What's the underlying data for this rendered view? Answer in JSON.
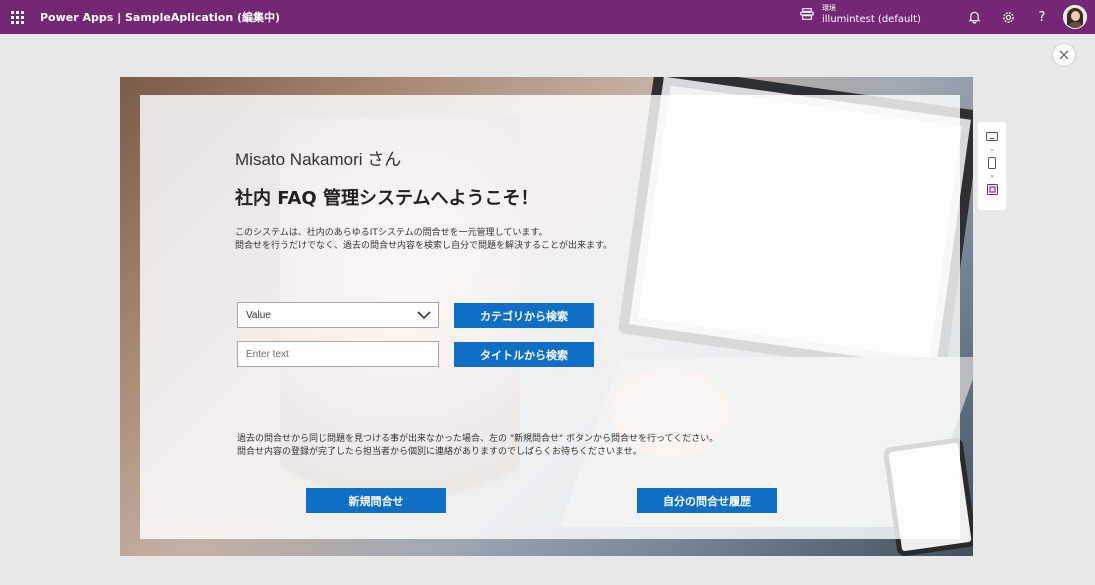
{
  "topbar": {
    "app_title": "Power Apps | SampleAplication (編集中)",
    "env_label": "環境",
    "env_value": "illumintest (default)",
    "help_label": "?"
  },
  "page": {
    "greeting": "Misato Nakamori さん",
    "welcome": "社内 FAQ 管理システムへようこそ！",
    "description": [
      "このシステムは、社内のあらゆるITシステムの問合せを一元管理しています。",
      "問合せを行うだけでなく、過去の問合せ内容を検索し自分で問題を解決することが出来ます。"
    ],
    "category_dropdown_value": "Value",
    "title_input_placeholder": "Enter text",
    "category_search_button": "カテゴリから検索",
    "title_search_button": "タイトルから検索",
    "note": [
      "過去の問合せから同じ問題を見つける事が出来なかった場合、左の \"新規問合せ\" ボタンから問合せを行ってください。",
      "問合せ内容の登録が完了したら担当者から個別に連絡がありますのでしばらくお待ちくださいませ。"
    ],
    "new_inquiry_button": "新規問合せ",
    "history_button": "自分の問合せ履歴"
  },
  "colors": {
    "topbar": "#742774",
    "button": "#0f6fc6"
  }
}
